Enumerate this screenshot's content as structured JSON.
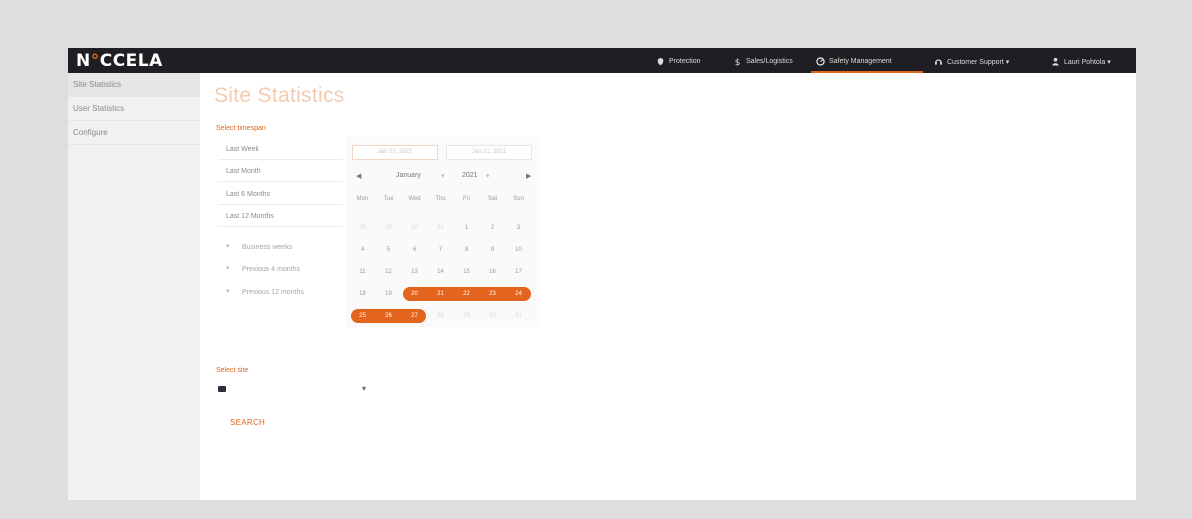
{
  "brand": {
    "logo_prefix": "N",
    "logo_dot": "°",
    "logo_suffix": "CCELA",
    "accent": "#e3641c"
  },
  "nav": {
    "items": [
      {
        "label": "Protection",
        "icon": "shield-hand-icon"
      },
      {
        "label": "Sales/Logistics",
        "icon": "dollar-icon"
      },
      {
        "label": "Safety Management",
        "icon": "gauge-icon",
        "active": true
      },
      {
        "label": "Customer Support ▾",
        "icon": "headset-icon"
      },
      {
        "label": "Lauri Pohtola ▾",
        "icon": "user-icon"
      }
    ]
  },
  "sidebar": {
    "items": [
      {
        "label": "Site Statistics",
        "active": true
      },
      {
        "label": "User Statistics"
      },
      {
        "label": "Configure"
      }
    ]
  },
  "main": {
    "title": "Site Statistics",
    "timespan_label": "Select timespan",
    "presets": [
      "Last Week",
      "Last Month",
      "Last 6 Months",
      "Last 12 Months"
    ],
    "dropdowns": [
      "Business weeks",
      "Previous 4 months",
      "Previous 12 months"
    ],
    "site_label": "Select site",
    "search_label": "SEARCH"
  },
  "calendar": {
    "start_date": "Jan 23, 2021",
    "end_date": "Jan 31, 2021",
    "month": "January",
    "year": "2021",
    "weekdays": [
      "Mon",
      "Tue",
      "Wed",
      "Thu",
      "Fri",
      "Sat",
      "Sun"
    ],
    "weeks": [
      [
        "28",
        "29",
        "30",
        "31",
        "1",
        "2",
        "3"
      ],
      [
        "4",
        "5",
        "6",
        "7",
        "8",
        "9",
        "10"
      ],
      [
        "11",
        "12",
        "13",
        "14",
        "15",
        "16",
        "17"
      ],
      [
        "18",
        "19",
        "20",
        "21",
        "22",
        "23",
        "24"
      ],
      [
        "25",
        "26",
        "27",
        "28",
        "29",
        "30",
        "31"
      ]
    ]
  }
}
